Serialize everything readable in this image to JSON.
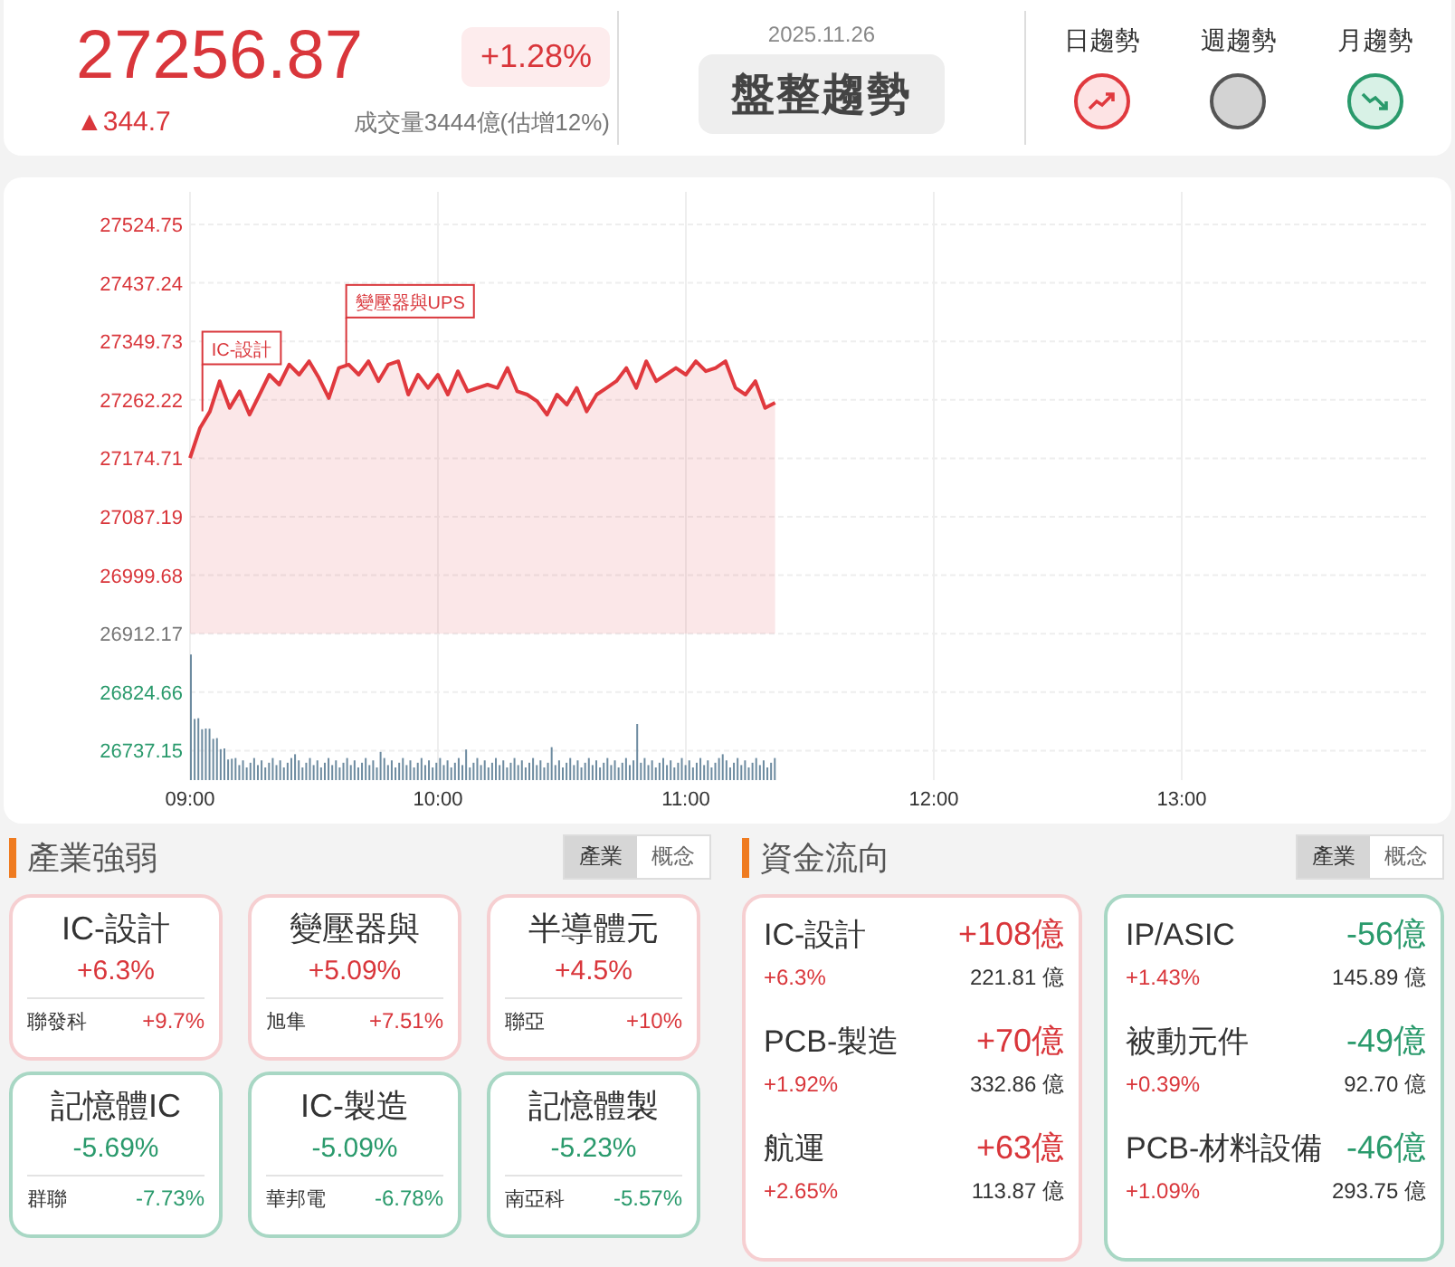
{
  "header": {
    "index_value": "27256.87",
    "change_percent": "+1.28%",
    "change_points": "▲344.7",
    "volume": "成交量3444億(估增12%)",
    "date": "2025.11.26",
    "status": "盤整趨勢",
    "trends": [
      {
        "label": "日趨勢",
        "kind": "up"
      },
      {
        "label": "週趨勢",
        "kind": "flat"
      },
      {
        "label": "月趨勢",
        "kind": "down"
      }
    ]
  },
  "chart": {
    "chart_data": {
      "type": "area",
      "x": [
        9,
        9.04,
        9.08,
        9.12,
        9.16,
        9.2,
        9.24,
        9.28,
        9.32,
        9.36,
        9.4,
        9.44,
        9.48,
        9.52,
        9.56,
        9.6,
        9.64,
        9.68,
        9.72,
        9.76,
        9.8,
        9.84,
        9.88,
        9.92,
        9.96,
        10,
        10.04,
        10.08,
        10.12,
        10.16,
        10.2,
        10.24,
        10.28,
        10.32,
        10.36,
        10.4,
        10.44,
        10.48,
        10.52,
        10.56,
        10.6,
        10.64,
        10.68,
        10.72,
        10.76,
        10.8,
        10.84,
        10.88,
        10.92,
        10.96,
        11,
        11.04,
        11.08,
        11.12,
        11.16,
        11.2,
        11.24,
        11.28,
        11.32,
        11.36
      ],
      "series": [
        {
          "color": "#e0393e",
          "values": [
            27175,
            27220,
            27245,
            27290,
            27250,
            27275,
            27240,
            27270,
            27300,
            27285,
            27315,
            27300,
            27320,
            27295,
            27265,
            27310,
            27315,
            27300,
            27320,
            27290,
            27315,
            27320,
            27270,
            27300,
            27280,
            27300,
            27270,
            27305,
            27275,
            27280,
            27285,
            27280,
            27310,
            27275,
            27270,
            27260,
            27240,
            27270,
            27255,
            27280,
            27245,
            27270,
            27280,
            27290,
            27310,
            27280,
            27320,
            27290,
            27300,
            27310,
            27300,
            27320,
            27305,
            27310,
            27320,
            27280,
            27270,
            27290,
            27250,
            27258
          ]
        }
      ],
      "grid": true,
      "xlim": [
        9,
        14
      ],
      "ylim": [
        26693,
        27524.75
      ],
      "xticks": [
        {
          "value": 9,
          "label": "09:00"
        },
        {
          "value": 10,
          "label": "10:00"
        },
        {
          "value": 11,
          "label": "11:00"
        },
        {
          "value": 12,
          "label": "12:00"
        },
        {
          "value": 13,
          "label": "13:00"
        }
      ],
      "yticks": [
        26737.15,
        26824.66,
        26912.17,
        26999.68,
        27087.19,
        27174.71,
        27262.22,
        27349.73,
        27437.24,
        27524.75
      ],
      "annotations": [
        {
          "x": 9.05,
          "y": 27245,
          "text": "IC-設計"
        },
        {
          "x": 9.63,
          "y": 27315,
          "text": "變壓器與UPS"
        }
      ]
    }
  },
  "sectors": {
    "title": "產業強弱",
    "tabs": [
      {
        "label": "產業",
        "selected": true
      },
      {
        "label": "概念",
        "selected": false
      }
    ],
    "cards": [
      {
        "name": "IC-設計",
        "change": "+6.3%",
        "top_stock": "聯發科",
        "top_change": "+9.7%",
        "kind": "up"
      },
      {
        "name": "變壓器與",
        "change": "+5.09%",
        "top_stock": "旭隼",
        "top_change": "+7.51%",
        "kind": "up"
      },
      {
        "name": "半導體元",
        "change": "+4.5%",
        "top_stock": "聯亞",
        "top_change": "+10%",
        "kind": "up"
      },
      {
        "name": "記憶體IC",
        "change": "-5.69%",
        "top_stock": "群聯",
        "top_change": "-7.73%",
        "kind": "down"
      },
      {
        "name": "IC-製造",
        "change": "-5.09%",
        "top_stock": "華邦電",
        "top_change": "-6.78%",
        "kind": "down"
      },
      {
        "name": "記憶體製",
        "change": "-5.23%",
        "top_stock": "南亞科",
        "top_change": "-5.57%",
        "kind": "down"
      }
    ]
  },
  "flows": {
    "title": "資金流向",
    "tabs": [
      {
        "label": "產業",
        "selected": true
      },
      {
        "label": "概念",
        "selected": false
      }
    ],
    "groups": [
      {
        "kind": "up",
        "items": [
          {
            "name": "IC-設計",
            "amount": "+108億",
            "change": "+6.3%",
            "turnover": "221.81 億"
          },
          {
            "name": "PCB-製造",
            "amount": "+70億",
            "change": "+1.92%",
            "turnover": "332.86 億"
          },
          {
            "name": "航運",
            "amount": "+63億",
            "change": "+2.65%",
            "turnover": "113.87 億"
          }
        ]
      },
      {
        "kind": "down",
        "items": [
          {
            "name": "IP/ASIC",
            "amount": "-56億",
            "change": "+1.43%",
            "turnover": "145.89 億"
          },
          {
            "name": "被動元件",
            "amount": "-49億",
            "change": "+0.39%",
            "turnover": "92.70 億"
          },
          {
            "name": "PCB-材料設備",
            "amount": "-46億",
            "change": "+1.09%",
            "turnover": "293.75 億"
          }
        ]
      }
    ]
  }
}
